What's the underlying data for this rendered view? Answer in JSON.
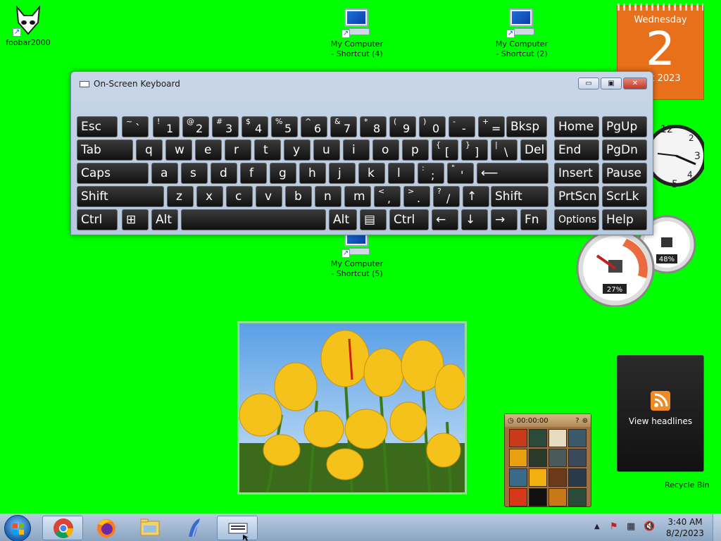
{
  "desktop": {
    "icons": [
      {
        "id": "foobar",
        "label": "foobar2000"
      },
      {
        "id": "pc4",
        "label_line1": "My Computer",
        "label_line2": "- Shortcut (4)"
      },
      {
        "id": "pc2",
        "label_line1": "My Computer",
        "label_line2": "- Shortcut (2)"
      },
      {
        "id": "pc5",
        "label_line1": "My Computer",
        "label_line2": "- Shortcut (5)"
      }
    ],
    "recycle_bin": "Recycle Bin"
  },
  "gadgets": {
    "calendar": {
      "day": "Wednesday",
      "date": "2",
      "month": "ust 2023"
    },
    "meters": {
      "cpu": "27%",
      "memory": "48%"
    },
    "puzzle": {
      "timer": "00:00:00"
    },
    "feed": {
      "label": "View headlines"
    }
  },
  "osk": {
    "title": "On-Screen Keyboard",
    "window_buttons": {
      "minimize": "▭",
      "restore": "▣",
      "close": "✕"
    },
    "rows": [
      [
        {
          "n": "esc",
          "t": "Esc"
        },
        {
          "n": "tilde",
          "s": "~",
          "m": "`"
        },
        {
          "n": "1",
          "s": "!",
          "m": "1"
        },
        {
          "n": "2",
          "s": "@",
          "m": "2"
        },
        {
          "n": "3",
          "s": "#",
          "m": "3"
        },
        {
          "n": "4",
          "s": "$",
          "m": "4"
        },
        {
          "n": "5",
          "s": "%",
          "m": "5"
        },
        {
          "n": "6",
          "s": "^",
          "m": "6"
        },
        {
          "n": "7",
          "s": "&",
          "m": "7"
        },
        {
          "n": "8",
          "s": "*",
          "m": "8"
        },
        {
          "n": "9",
          "s": "(",
          "m": "9"
        },
        {
          "n": "0",
          "s": ")",
          "m": "0"
        },
        {
          "n": "minus",
          "s": "-",
          "m": "-"
        },
        {
          "n": "equals",
          "s": "+",
          "m": "="
        },
        {
          "n": "bksp",
          "t": "Bksp"
        },
        {
          "n": "home",
          "t": "Home"
        },
        {
          "n": "pgup",
          "t": "PgUp"
        }
      ],
      [
        {
          "n": "tab",
          "t": "Tab"
        },
        {
          "n": "q",
          "t": "q"
        },
        {
          "n": "w",
          "t": "w"
        },
        {
          "n": "e",
          "t": "e"
        },
        {
          "n": "r",
          "t": "r"
        },
        {
          "n": "t",
          "t": "t"
        },
        {
          "n": "y",
          "t": "y"
        },
        {
          "n": "u",
          "t": "u"
        },
        {
          "n": "i",
          "t": "i"
        },
        {
          "n": "o",
          "t": "o"
        },
        {
          "n": "p",
          "t": "p"
        },
        {
          "n": "lbracket",
          "s": "{",
          "m": "["
        },
        {
          "n": "rbracket",
          "s": "}",
          "m": "]"
        },
        {
          "n": "backslash",
          "s": "|",
          "m": "\\"
        },
        {
          "n": "del",
          "t": "Del"
        },
        {
          "n": "end",
          "t": "End"
        },
        {
          "n": "pgdn",
          "t": "PgDn"
        }
      ],
      [
        {
          "n": "caps",
          "t": "Caps"
        },
        {
          "n": "a",
          "t": "a"
        },
        {
          "n": "s",
          "t": "s"
        },
        {
          "n": "d",
          "t": "d"
        },
        {
          "n": "f",
          "t": "f"
        },
        {
          "n": "g",
          "t": "g"
        },
        {
          "n": "h",
          "t": "h"
        },
        {
          "n": "j",
          "t": "j"
        },
        {
          "n": "k",
          "t": "k"
        },
        {
          "n": "l",
          "t": "l"
        },
        {
          "n": "semicolon",
          "s": ":",
          "m": ";"
        },
        {
          "n": "quote",
          "s": "\"",
          "m": "'"
        },
        {
          "n": "enter",
          "t": "⟵"
        },
        {
          "n": "insert",
          "t": "Insert"
        },
        {
          "n": "pause",
          "t": "Pause"
        }
      ],
      [
        {
          "n": "lshift",
          "t": "Shift"
        },
        {
          "n": "z",
          "t": "z"
        },
        {
          "n": "x",
          "t": "x"
        },
        {
          "n": "c",
          "t": "c"
        },
        {
          "n": "v",
          "t": "v"
        },
        {
          "n": "b",
          "t": "b"
        },
        {
          "n": "n",
          "t": "n"
        },
        {
          "n": "m",
          "t": "m"
        },
        {
          "n": "comma",
          "s": "<",
          "m": ","
        },
        {
          "n": "period",
          "s": ">",
          "m": "."
        },
        {
          "n": "slash",
          "s": "?",
          "m": "/"
        },
        {
          "n": "up",
          "t": "↑"
        },
        {
          "n": "rshift",
          "t": "Shift"
        },
        {
          "n": "prtscn",
          "t": "PrtScn"
        },
        {
          "n": "scrlk",
          "t": "ScrLk"
        }
      ],
      [
        {
          "n": "lctrl",
          "t": "Ctrl"
        },
        {
          "n": "win",
          "t": "⊞"
        },
        {
          "n": "lalt",
          "t": "Alt"
        },
        {
          "n": "space",
          "t": ""
        },
        {
          "n": "ralt",
          "t": "Alt"
        },
        {
          "n": "menu",
          "t": "▤"
        },
        {
          "n": "rctrl",
          "t": "Ctrl"
        },
        {
          "n": "left",
          "t": "←"
        },
        {
          "n": "down",
          "t": "↓"
        },
        {
          "n": "right",
          "t": "→"
        },
        {
          "n": "fn",
          "t": "Fn"
        },
        {
          "n": "options",
          "t": "Options"
        },
        {
          "n": "help",
          "t": "Help"
        }
      ]
    ]
  },
  "taskbar": {
    "apps": [
      "chrome",
      "firefox",
      "explorer",
      "unknown-app",
      "osk"
    ],
    "time": "3:40 AM",
    "date": "8/2/2023"
  }
}
